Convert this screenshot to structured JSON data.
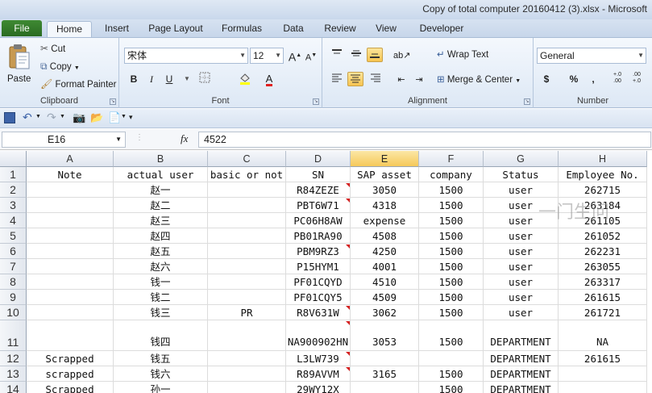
{
  "window": {
    "title": "Copy of total computer 20160412 (3).xlsx - Microsoft"
  },
  "tabs": {
    "file": "File",
    "home": "Home",
    "insert": "Insert",
    "page_layout": "Page Layout",
    "formulas": "Formulas",
    "data": "Data",
    "review": "Review",
    "view": "View",
    "developer": "Developer"
  },
  "clipboard": {
    "paste": "Paste",
    "cut": "Cut",
    "copy": "Copy",
    "format_painter": "Format Painter",
    "label": "Clipboard"
  },
  "font": {
    "name": "宋体",
    "size": "12",
    "bold": "B",
    "italic": "I",
    "underline": "U",
    "grow": "A",
    "shrink": "A",
    "label": "Font"
  },
  "alignment": {
    "wrap_text": "Wrap Text",
    "merge_center": "Merge & Center",
    "label": "Alignment"
  },
  "number": {
    "format": "General",
    "currency": "$",
    "percent": "%",
    "comma": ",",
    "inc_decimal": "+.0 .00",
    "dec_decimal": ".00 +.0",
    "label": "Number"
  },
  "formula_bar": {
    "name_box": "E16",
    "fx": "fx",
    "content": "4522"
  },
  "colors": {
    "file_tab": "#2f7a27",
    "selected_column": "#f6c95a",
    "comment_marker": "#d42020"
  },
  "columns": [
    "A",
    "B",
    "C",
    "D",
    "E",
    "F",
    "G",
    "H"
  ],
  "rows": [
    {
      "num": "1",
      "cells": [
        "Note",
        "actual user",
        "basic or not",
        "SN",
        "SAP asset",
        "company",
        "Status",
        "Employee No."
      ]
    },
    {
      "num": "2",
      "cells": [
        "",
        "赵一",
        "",
        "R84ZEZE",
        "3050",
        "1500",
        "user",
        "262715"
      ]
    },
    {
      "num": "3",
      "cells": [
        "",
        "赵二",
        "",
        "PBT6W71",
        "4318",
        "1500",
        "user",
        "263184"
      ]
    },
    {
      "num": "4",
      "cells": [
        "",
        "赵三",
        "",
        "PC06H8AW",
        "expense",
        "1500",
        "user",
        "261105"
      ]
    },
    {
      "num": "5",
      "cells": [
        "",
        "赵四",
        "",
        "PB01RA90",
        "4508",
        "1500",
        "user",
        "261052"
      ]
    },
    {
      "num": "6",
      "cells": [
        "",
        "赵五",
        "",
        "PBM9RZ3",
        "4250",
        "1500",
        "user",
        "262231"
      ]
    },
    {
      "num": "7",
      "cells": [
        "",
        "赵六",
        "",
        "P15HYM1",
        "4001",
        "1500",
        "user",
        "263055"
      ]
    },
    {
      "num": "8",
      "cells": [
        "",
        "钱一",
        "",
        "PF01CQYD",
        "4510",
        "1500",
        "user",
        "263317"
      ]
    },
    {
      "num": "9",
      "cells": [
        "",
        "钱二",
        "",
        "PF01CQY5",
        "4509",
        "1500",
        "user",
        "261615"
      ]
    },
    {
      "num": "10",
      "cells": [
        "",
        "钱三",
        "PR",
        "R8V631W",
        "3062",
        "1500",
        "user",
        "261721"
      ]
    },
    {
      "num": "11",
      "cells": [
        "",
        "钱四",
        "",
        "NA900902HN",
        "3053",
        "1500",
        "DEPARTMENT",
        "NA"
      ]
    },
    {
      "num": "12",
      "cells": [
        "Scrapped",
        "钱五",
        "",
        "L3LW739",
        "",
        "",
        "DEPARTMENT",
        "261615"
      ]
    },
    {
      "num": "13",
      "cells": [
        "scrapped",
        "钱六",
        "",
        "R89AVVM",
        "3165",
        "1500",
        "DEPARTMENT",
        ""
      ]
    },
    {
      "num": "14",
      "cells": [
        "Scrapped",
        "孙一",
        "",
        "29WY12X",
        "",
        "1500",
        "DEPARTMENT",
        ""
      ]
    }
  ],
  "watermark": "一门生问"
}
